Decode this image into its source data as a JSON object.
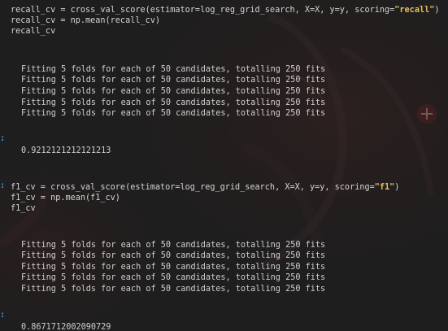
{
  "cells": [
    {
      "code": [
        {
          "pre": "recall_cv = cross_val_score(estimator=log_reg_grid_search, X=X, y=y, scoring=",
          "str": "\"recall\"",
          "post": ")"
        },
        {
          "pre": "recall_cv = np.mean(recall_cv)",
          "str": "",
          "post": ""
        },
        {
          "pre": "recall_cv",
          "str": "",
          "post": ""
        }
      ],
      "stream": [
        "Fitting 5 folds for each of 50 candidates, totalling 250 fits",
        "Fitting 5 folds for each of 50 candidates, totalling 250 fits",
        "Fitting 5 folds for each of 50 candidates, totalling 250 fits",
        "Fitting 5 folds for each of 50 candidates, totalling 250 fits",
        "Fitting 5 folds for each of 50 candidates, totalling 250 fits"
      ],
      "prompt": ":",
      "result": "0.9212121212121213"
    },
    {
      "code_prompt": ":",
      "code": [
        {
          "pre": "f1_cv = cross_val_score(estimator=log_reg_grid_search, X=X, y=y, scoring=",
          "str": "\"f1\"",
          "post": ")"
        },
        {
          "pre": "f1_cv = np.mean(f1_cv)",
          "str": "",
          "post": ""
        },
        {
          "pre": "f1_cv",
          "str": "",
          "post": ""
        }
      ],
      "stream": [
        "Fitting 5 folds for each of 50 candidates, totalling 250 fits",
        "Fitting 5 folds for each of 50 candidates, totalling 250 fits",
        "Fitting 5 folds for each of 50 candidates, totalling 250 fits",
        "Fitting 5 folds for each of 50 candidates, totalling 250 fits",
        "Fitting 5 folds for each of 50 candidates, totalling 250 fits"
      ],
      "prompt": ":",
      "result": "0.8671712002090729"
    }
  ],
  "colors": {
    "background": "#1e1e1e",
    "code_text": "#d4d4d4",
    "string_accent": "#e0c060",
    "prompt_accent": "#3c9fd6"
  }
}
